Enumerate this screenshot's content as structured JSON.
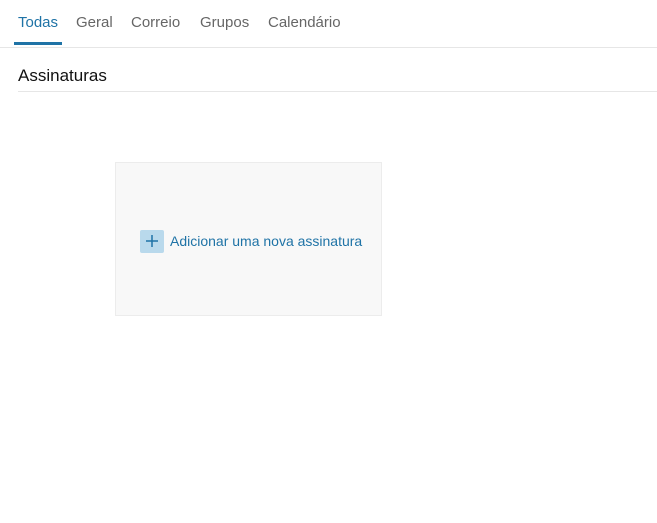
{
  "tabs": [
    {
      "label": "Todas",
      "active": true
    },
    {
      "label": "Geral",
      "active": false
    },
    {
      "label": "Correio",
      "active": false
    },
    {
      "label": "Grupos",
      "active": false
    },
    {
      "label": "Calendário",
      "active": false
    }
  ],
  "section": {
    "title": "Assinaturas"
  },
  "add_card": {
    "label": "Adicionar uma nova assinatura",
    "icon": "plus-icon"
  },
  "colors": {
    "accent": "#1f73a6",
    "icon_bg": "#b9d9ec",
    "card_bg": "#f8f8f8",
    "tab_text": "#666666"
  }
}
